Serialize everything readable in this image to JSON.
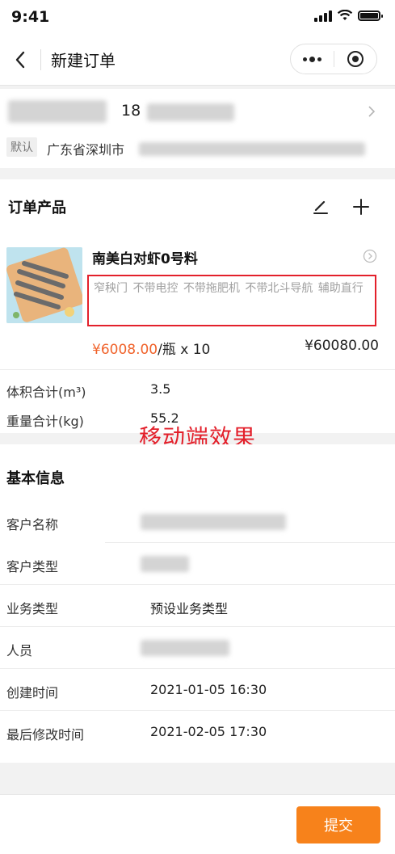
{
  "status_bar": {
    "time": "9:41"
  },
  "nav": {
    "title": "新建订单"
  },
  "address": {
    "phone_prefix": "18",
    "tag": "默认",
    "city": "广东省深圳市"
  },
  "products": {
    "section_title": "订单产品",
    "items": [
      {
        "name": "南美白对虾0号料",
        "specs": "窄秧门  不带电控  不带拖肥机  不带北斗导航  辅助直行",
        "price": "¥6008.00",
        "unit_qty": "/瓶 x 10",
        "total": "¥60080.00"
      }
    ],
    "stats": [
      {
        "label": "体积合计(m³)",
        "value": "3.5"
      },
      {
        "label": "重量合计(kg)",
        "value": "55.2"
      }
    ]
  },
  "watermark": "移动端效果",
  "basic": {
    "section_title": "基本信息",
    "rows": [
      {
        "label": "客户名称",
        "value": ""
      },
      {
        "label": "客户类型",
        "value": ""
      },
      {
        "label": "业务类型",
        "value": "预设业务类型"
      },
      {
        "label": "人员",
        "value": ""
      },
      {
        "label": "创建时间",
        "value": "2021-01-05 16:30"
      },
      {
        "label": "最后修改时间",
        "value": "2021-02-05 17:30"
      }
    ]
  },
  "footer": {
    "submit_label": "提交"
  },
  "colors": {
    "accent": "#f7821b",
    "price": "#f0622a",
    "highlight_border": "#e3202b"
  }
}
